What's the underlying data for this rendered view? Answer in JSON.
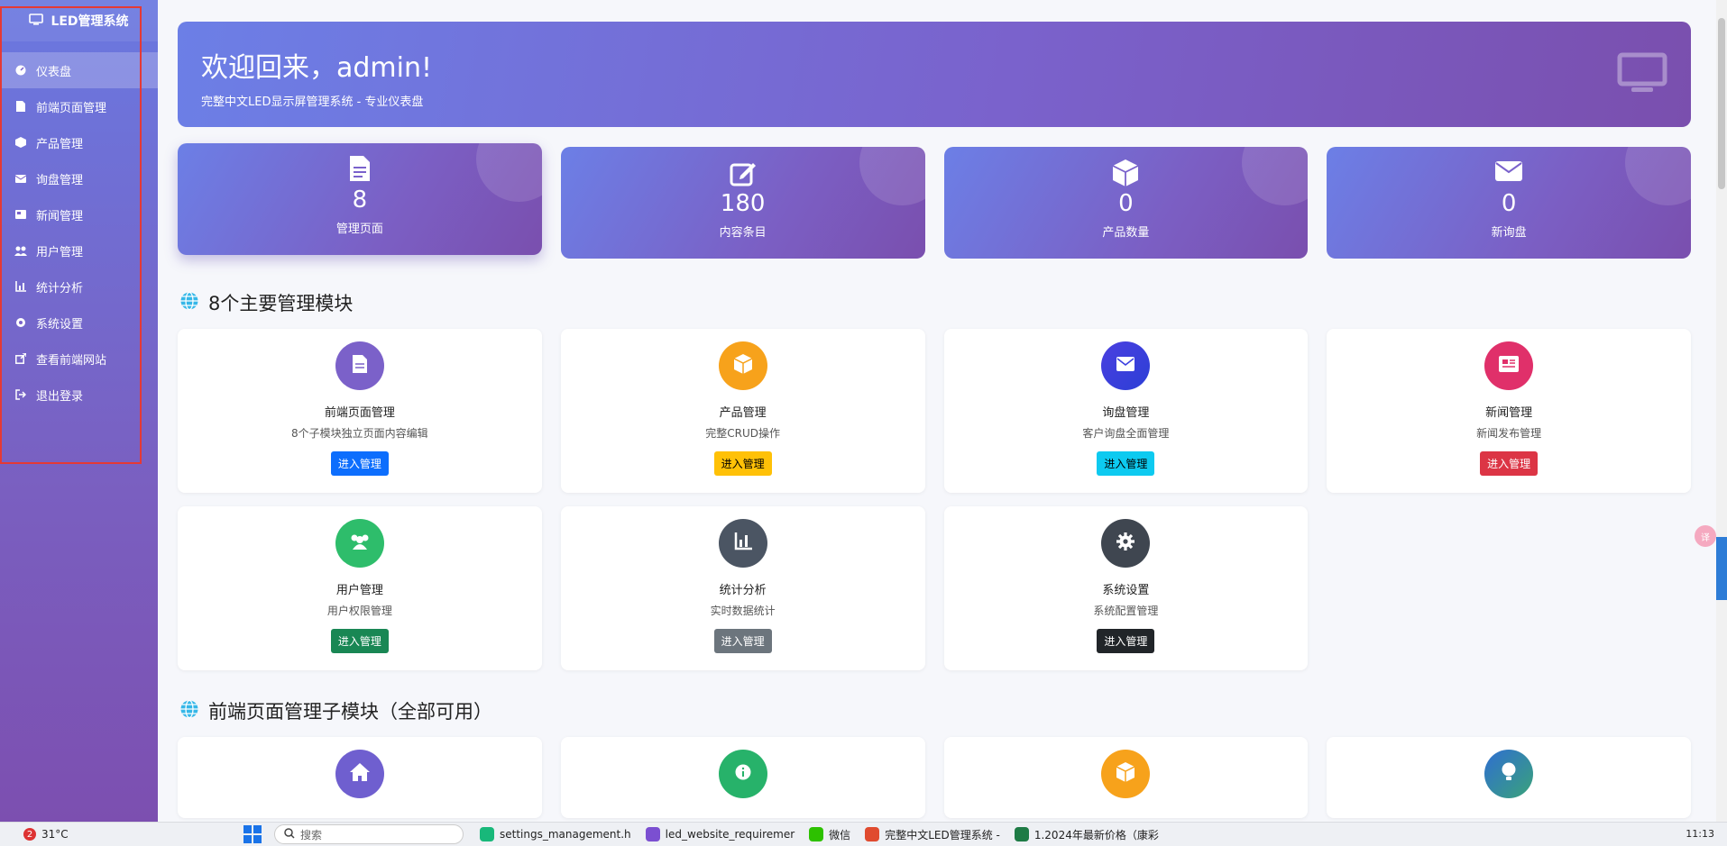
{
  "sidebar": {
    "brand": "LED管理系统",
    "items": [
      {
        "label": "仪表盘",
        "icon": "dashboard-icon"
      },
      {
        "label": "前端页面管理",
        "icon": "file-icon"
      },
      {
        "label": "产品管理",
        "icon": "box-icon"
      },
      {
        "label": "询盘管理",
        "icon": "envelope-icon"
      },
      {
        "label": "新闻管理",
        "icon": "newspaper-icon"
      },
      {
        "label": "用户管理",
        "icon": "users-icon"
      },
      {
        "label": "统计分析",
        "icon": "chart-icon"
      },
      {
        "label": "系统设置",
        "icon": "gear-icon"
      },
      {
        "label": "查看前端网站",
        "icon": "external-link-icon"
      },
      {
        "label": "退出登录",
        "icon": "logout-icon"
      }
    ]
  },
  "hero": {
    "title": "欢迎回来，admin!",
    "subtitle": "完整中文LED显示屏管理系统 - 专业仪表盘"
  },
  "stats": [
    {
      "value": "8",
      "label": "管理页面",
      "icon": "file-icon"
    },
    {
      "value": "180",
      "label": "内容条目",
      "icon": "edit-icon"
    },
    {
      "value": "0",
      "label": "产品数量",
      "icon": "box-icon"
    },
    {
      "value": "0",
      "label": "新询盘",
      "icon": "envelope-icon"
    }
  ],
  "modules_title": "8个主要管理模块",
  "modules": [
    {
      "title": "前端页面管理",
      "desc": "8个子模块独立页面内容编辑",
      "button": "进入管理",
      "circle_color": "#7b61c9",
      "button_color": "#0d6efd",
      "button_text_color": "#ffffff"
    },
    {
      "title": "产品管理",
      "desc": "完整CRUD操作",
      "button": "进入管理",
      "circle_color": "#f7a21b",
      "button_color": "#ffc107",
      "button_text_color": "#000000"
    },
    {
      "title": "询盘管理",
      "desc": "客户询盘全面管理",
      "button": "进入管理",
      "circle_color": "#3b3fe0",
      "button_color": "#0dcaf0",
      "button_text_color": "#000000"
    },
    {
      "title": "新闻管理",
      "desc": "新闻发布管理",
      "button": "进入管理",
      "circle_color": "#e0306a",
      "button_color": "#dc3545",
      "button_text_color": "#ffffff"
    },
    {
      "title": "用户管理",
      "desc": "用户权限管理",
      "button": "进入管理",
      "circle_color": "#2ebd6b",
      "button_color": "#198754",
      "button_text_color": "#ffffff"
    },
    {
      "title": "统计分析",
      "desc": "实时数据统计",
      "button": "进入管理",
      "circle_color": "#4b5563",
      "button_color": "#6c757d",
      "button_text_color": "#ffffff"
    },
    {
      "title": "系统设置",
      "desc": "系统配置管理",
      "button": "进入管理",
      "circle_color": "#3f4650",
      "button_color": "#212529",
      "button_text_color": "#ffffff"
    }
  ],
  "submodules_title": "前端页面管理子模块（全部可用）",
  "submodules": [
    {
      "circle_color": "#6f5fcf",
      "icon": "home-icon"
    },
    {
      "circle_color": "#27b26a",
      "icon": "info-icon"
    },
    {
      "circle_color": "#f7a21b",
      "icon": "box-icon"
    },
    {
      "circle_color": "#2f6ed1",
      "icon": "lightbulb-icon"
    }
  ],
  "taskbar": {
    "weather_badge": "2",
    "temperature": "31°C",
    "search_placeholder": "搜索",
    "apps": [
      {
        "label": "settings_management.h",
        "color": "#18b87a"
      },
      {
        "label": "led_website_requiremer",
        "color": "#7b4fd1"
      },
      {
        "label": "微信",
        "color": "#2dc100"
      },
      {
        "label": "完整中文LED管理系统 -",
        "color": "#e04b2f"
      },
      {
        "label": "1.2024年最新价格（康彩",
        "color": "#1e7b45"
      }
    ],
    "clock": "11:13"
  }
}
